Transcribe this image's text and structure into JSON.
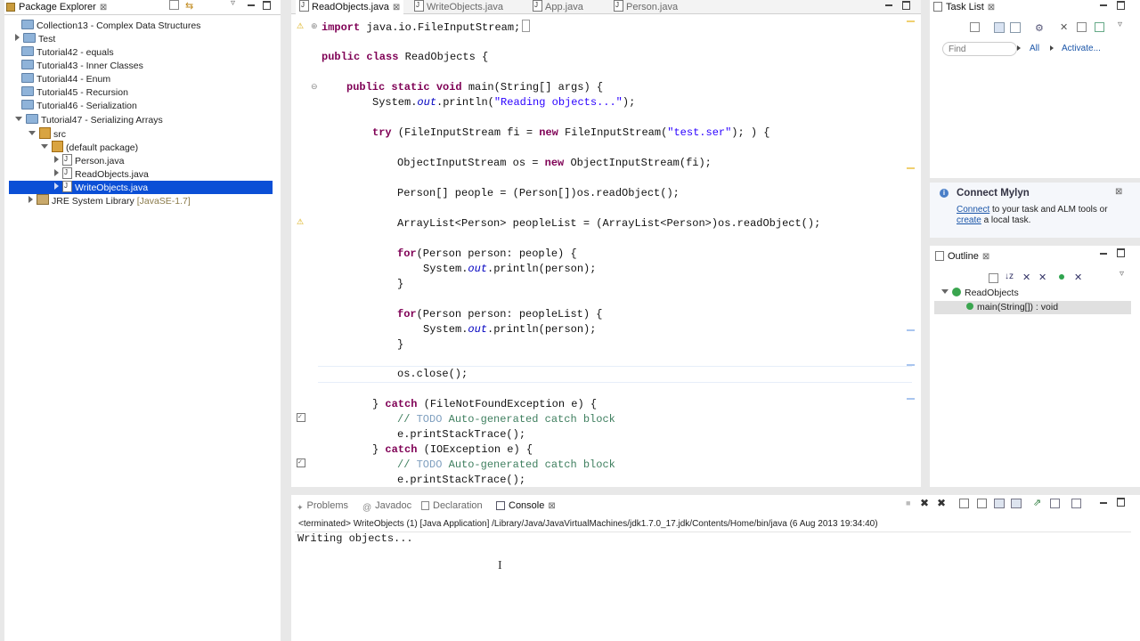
{
  "package_explorer": {
    "title": "Package Explorer",
    "items": [
      {
        "label": "Collection13 - Complex Data Structures"
      },
      {
        "label": "Test"
      },
      {
        "label": "Tutorial42 - equals"
      },
      {
        "label": "Tutorial43 - Inner Classes"
      },
      {
        "label": "Tutorial44 - Enum"
      },
      {
        "label": "Tutorial45 - Recursion"
      },
      {
        "label": "Tutorial46 - Serialization"
      },
      {
        "label": "Tutorial47 - Serializing Arrays"
      },
      {
        "label": "src"
      },
      {
        "label": "(default package)"
      },
      {
        "label": "Person.java"
      },
      {
        "label": "ReadObjects.java"
      },
      {
        "label": "WriteObjects.java"
      },
      {
        "label": "JRE System Library",
        "suffix": "[JavaSE-1.7]"
      }
    ]
  },
  "editor": {
    "tabs": [
      {
        "label": "ReadObjects.java"
      },
      {
        "label": "WriteObjects.java"
      },
      {
        "label": "App.java"
      },
      {
        "label": "Person.java"
      }
    ],
    "lines": {
      "l1_kw": "import",
      "l1_rest": " java.io.FileInputStream;",
      "l2_kw": "public class",
      "l2_rest": " ReadObjects {",
      "l3_kw": "public static void",
      "l3_rest": " main(String[] args) {",
      "l4_a": "System.",
      "l4_it": "out",
      "l4_b": ".println(",
      "l4_str": "\"Reading objects...\"",
      "l4_c": ");",
      "l5_kw": "try",
      "l5_a": " (FileInputStream fi = ",
      "l5_kw2": "new",
      "l5_b": " FileInputStream(",
      "l5_str": "\"test.ser\"",
      "l5_c": "); ) {",
      "l6_a": "ObjectInputStream os = ",
      "l6_kw": "new",
      "l6_b": " ObjectInputStream(fi);",
      "l7": "Person[] people = (Person[])os.readObject();",
      "l8": "ArrayList<Person> peopleList = (ArrayList<Person>)os.readObject();",
      "l9_kw": "for",
      "l9_rest": "(Person person: people) {",
      "l10_a": "System.",
      "l10_it": "out",
      "l10_b": ".println(person);",
      "l11": "}",
      "l12_kw": "for",
      "l12_rest": "(Person person: peopleList) {",
      "l13_a": "System.",
      "l13_it": "out",
      "l13_b": ".println(person);",
      "l14": "}",
      "l15": "os.close();",
      "l16_a": "} ",
      "l16_kw": "catch",
      "l16_b": " (FileNotFoundException e) {",
      "l17_a": "// ",
      "l17_todo": "TODO",
      "l17_b": " Auto-generated catch block",
      "l18": "e.printStackTrace();",
      "l19_a": "} ",
      "l19_kw": "catch",
      "l19_b": " (IOException e) {",
      "l20_a": "// ",
      "l20_todo": "TODO",
      "l20_b": " Auto-generated catch block",
      "l21": "e.printStackTrace();"
    }
  },
  "task_list": {
    "title": "Task List",
    "find_placeholder": "Find",
    "all_label": "All",
    "activate_label": "Activate..."
  },
  "mylyn": {
    "title": "Connect Mylyn",
    "connect_link": "Connect",
    "text1": " to your task and ALM tools or",
    "create_link": "create",
    "text2": " a local task."
  },
  "outline": {
    "title": "Outline",
    "class_name": "ReadObjects",
    "method": "main(String[]) : void"
  },
  "console": {
    "tabs": [
      {
        "label": "Problems"
      },
      {
        "label": "Javadoc"
      },
      {
        "label": "Declaration"
      },
      {
        "label": "Console"
      }
    ],
    "status": "<terminated> WriteObjects (1) [Java Application] /Library/Java/JavaVirtualMachines/jdk1.7.0_17.jdk/Contents/Home/bin/java (6 Aug 2013 19:34:40)",
    "output": "Writing objects..."
  }
}
